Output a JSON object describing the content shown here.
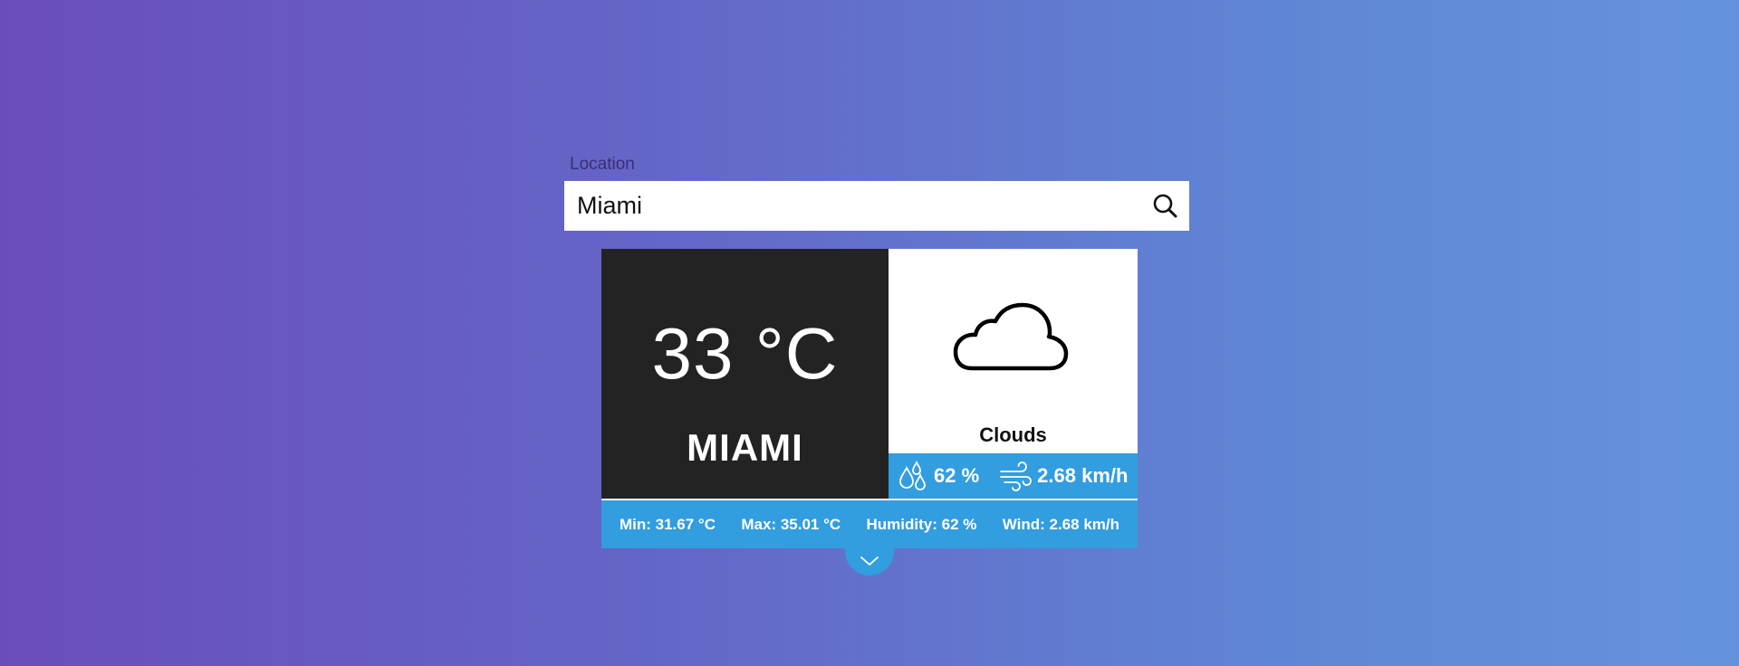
{
  "search": {
    "label": "Location",
    "value": "Miami",
    "icon": "search-icon"
  },
  "weather": {
    "temperature": "33 °C",
    "city": "MIAMI",
    "condition": "Clouds",
    "condition_icon": "cloud-icon",
    "humidity_short": "62 %",
    "wind_short": "2.68 km/h"
  },
  "details": {
    "min": "Min: 31.67 °C",
    "max": "Max: 35.01 °C",
    "humidity": "Humidity: 62 %",
    "wind": "Wind: 2.68 km/h"
  },
  "colors": {
    "accent": "#329ddf",
    "dark_panel": "#232323",
    "gradient_start": "#6a4dba",
    "gradient_end": "#6592de"
  }
}
